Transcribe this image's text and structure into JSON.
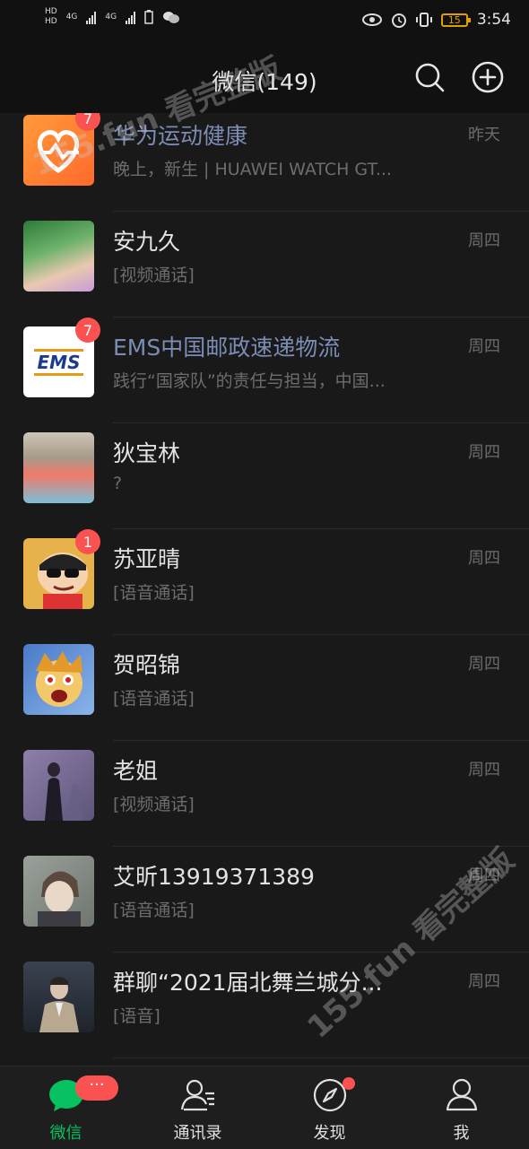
{
  "status_bar": {
    "time": "3:54",
    "battery": "15",
    "hd1": "HD",
    "hd2": "HD",
    "net1": "4G",
    "net2": "4G"
  },
  "header": {
    "title": "微信(149)"
  },
  "chats": [
    {
      "name": "华为运动健康",
      "preview": "晚上，新生 | HUAWEI WATCH GT...",
      "time": "昨天",
      "badge": "7",
      "official": true
    },
    {
      "name": "安九久",
      "preview": "[视频通话]",
      "time": "周四",
      "badge": ""
    },
    {
      "name": "EMS中国邮政速递物流",
      "preview": "践行“国家队”的责任与担当，中国...",
      "time": "周四",
      "badge": "7",
      "official": true,
      "logo_text": "EMS"
    },
    {
      "name": "狄宝林",
      "preview": "?",
      "time": "周四",
      "badge": ""
    },
    {
      "name": "苏亚晴",
      "preview": "[语音通话]",
      "time": "周四",
      "badge": "1"
    },
    {
      "name": "贺昭锦",
      "preview": "[语音通话]",
      "time": "周四",
      "badge": ""
    },
    {
      "name": "老姐",
      "preview": "[视频通话]",
      "time": "周四",
      "badge": ""
    },
    {
      "name": "艾昕13919371389",
      "preview": "[语音通话]",
      "time": "周四",
      "badge": ""
    },
    {
      "name": "群聊“2021届北舞兰城分...",
      "preview": "[语音]",
      "time": "周四",
      "badge": ""
    }
  ],
  "watermarks": {
    "top": "155.fun 看完整版",
    "bottom": "155.fun 看完整版"
  },
  "tabs": [
    {
      "label": "微信",
      "icon": "chat-bubble-icon",
      "badge": "···",
      "active": true
    },
    {
      "label": "通讯录",
      "icon": "contacts-icon"
    },
    {
      "label": "发现",
      "icon": "compass-icon",
      "dot": true
    },
    {
      "label": "我",
      "icon": "person-icon"
    }
  ],
  "colors": {
    "accent": "#07c160",
    "badge": "#fa5151",
    "official_name": "#7b8cb5",
    "background": "#191919"
  }
}
